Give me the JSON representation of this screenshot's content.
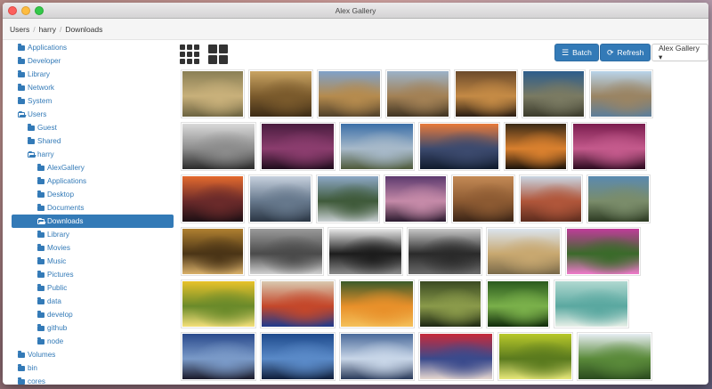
{
  "window": {
    "title": "Alex Gallery"
  },
  "breadcrumb": [
    "Users",
    "harry",
    "Downloads"
  ],
  "sidebar": {
    "items": [
      {
        "label": "Applications",
        "level": 0,
        "open": false,
        "selected": false
      },
      {
        "label": "Developer",
        "level": 0,
        "open": false,
        "selected": false
      },
      {
        "label": "Library",
        "level": 0,
        "open": false,
        "selected": false
      },
      {
        "label": "Network",
        "level": 0,
        "open": false,
        "selected": false
      },
      {
        "label": "System",
        "level": 0,
        "open": false,
        "selected": false
      },
      {
        "label": "Users",
        "level": 0,
        "open": true,
        "selected": false
      },
      {
        "label": "Guest",
        "level": 1,
        "open": false,
        "selected": false
      },
      {
        "label": "Shared",
        "level": 1,
        "open": false,
        "selected": false
      },
      {
        "label": "harry",
        "level": 1,
        "open": true,
        "selected": false
      },
      {
        "label": "AlexGallery",
        "level": 2,
        "open": false,
        "selected": false
      },
      {
        "label": "Applications",
        "level": 2,
        "open": false,
        "selected": false
      },
      {
        "label": "Desktop",
        "level": 2,
        "open": false,
        "selected": false
      },
      {
        "label": "Documents",
        "level": 2,
        "open": false,
        "selected": false
      },
      {
        "label": "Downloads",
        "level": 2,
        "open": true,
        "selected": true
      },
      {
        "label": "Library",
        "level": 2,
        "open": false,
        "selected": false
      },
      {
        "label": "Movies",
        "level": 2,
        "open": false,
        "selected": false
      },
      {
        "label": "Music",
        "level": 2,
        "open": false,
        "selected": false
      },
      {
        "label": "Pictures",
        "level": 2,
        "open": false,
        "selected": false
      },
      {
        "label": "Public",
        "level": 2,
        "open": false,
        "selected": false
      },
      {
        "label": "data",
        "level": 2,
        "open": false,
        "selected": false
      },
      {
        "label": "develop",
        "level": 2,
        "open": false,
        "selected": false
      },
      {
        "label": "github",
        "level": 2,
        "open": false,
        "selected": false
      },
      {
        "label": "node",
        "level": 2,
        "open": false,
        "selected": false
      },
      {
        "label": "Volumes",
        "level": 0,
        "open": false,
        "selected": false
      },
      {
        "label": "bin",
        "level": 0,
        "open": false,
        "selected": false
      },
      {
        "label": "cores",
        "level": 0,
        "open": false,
        "selected": false
      }
    ]
  },
  "toolbar": {
    "batch_label": "Batch",
    "refresh_label": "Refresh",
    "gallery_select_label": "Alex Gallery ▾",
    "small_grid_icon": "grid-9-icon",
    "large_grid_icon": "grid-4-icon",
    "batch_icon": "list-icon",
    "refresh_icon": "refresh-icon"
  },
  "colors": {
    "accent": "#337ab7",
    "accent_border": "#2e6da4"
  },
  "gallery": {
    "rows": [
      [
        {
          "name": "cheetah-running",
          "colors": [
            "#8a7f55",
            "#c8b07a",
            "#6b6240"
          ]
        },
        {
          "name": "leopard-closeup",
          "colors": [
            "#c9a463",
            "#7a5a2c",
            "#3d2c16"
          ]
        },
        {
          "name": "leopard-on-branch",
          "colors": [
            "#7fa1c9",
            "#b58b4e",
            "#50402a"
          ]
        },
        {
          "name": "leopard-resting-tree",
          "colors": [
            "#9bb2c8",
            "#a38155",
            "#3f3322"
          ]
        },
        {
          "name": "jaguar-lying",
          "colors": [
            "#6b4a2b",
            "#c48a45",
            "#2a1d12"
          ]
        },
        {
          "name": "jaguar-on-log",
          "colors": [
            "#2d5d8c",
            "#7a7a62",
            "#3a3a2b"
          ]
        },
        {
          "name": "jaguar-reflection",
          "colors": [
            "#b9d4ea",
            "#9a8463",
            "#5c7e9a"
          ]
        }
      ],
      [
        {
          "name": "statue-of-liberty",
          "colors": [
            "#d9d9d9",
            "#8c8c8c",
            "#2a2a2a"
          ]
        },
        {
          "name": "imac-purple",
          "colors": [
            "#4a1d3f",
            "#8b3d6e",
            "#1f0c1c"
          ]
        },
        {
          "name": "mountain-valley",
          "colors": [
            "#3b6fa8",
            "#a7b9c9",
            "#4e5a3a"
          ]
        },
        {
          "name": "mountain-lake-sunset",
          "colors": [
            "#e87a3a",
            "#3c4a6e",
            "#0f1a2c"
          ]
        },
        {
          "name": "tiger-in-water",
          "colors": [
            "#3a2a16",
            "#d9802e",
            "#1a120a"
          ]
        },
        {
          "name": "purple-wave",
          "colors": [
            "#7b1e4f",
            "#c45a8c",
            "#2a0a1e"
          ]
        }
      ],
      [
        {
          "name": "sunset-sea",
          "colors": [
            "#e46a2e",
            "#6a2a2a",
            "#1c0f14"
          ]
        },
        {
          "name": "lake-mountains",
          "colors": [
            "#c7d1de",
            "#66788c",
            "#2b3644"
          ]
        },
        {
          "name": "mountain-lake-reflection",
          "colors": [
            "#8da8c7",
            "#3f5a3a",
            "#c8cfd2"
          ]
        },
        {
          "name": "purple-mountains",
          "colors": [
            "#5c3a6e",
            "#c58aa8",
            "#2a1a2e"
          ]
        },
        {
          "name": "bear-sleeping",
          "colors": [
            "#c48a55",
            "#8c5a32",
            "#3a2416"
          ]
        },
        {
          "name": "red-rock-valley",
          "colors": [
            "#c9d6e3",
            "#b0563a",
            "#5c2c1e"
          ]
        },
        {
          "name": "yosemite-cliffs",
          "colors": [
            "#5a8ab0",
            "#7a8c6a",
            "#2c3a22"
          ]
        }
      ],
      [
        {
          "name": "leopard-face",
          "colors": [
            "#b08030",
            "#4a3416",
            "#d9b06a"
          ]
        },
        {
          "name": "wolf-grey",
          "colors": [
            "#9a9a9a",
            "#4a4a4a",
            "#d0d0d0"
          ]
        },
        {
          "name": "black-wolf-snow",
          "colors": [
            "#e8e8e8",
            "#1c1c1c",
            "#8a8a8a"
          ]
        },
        {
          "name": "black-wolf-forest",
          "colors": [
            "#c8c8c8",
            "#2a2a2a",
            "#6a6a6a"
          ]
        },
        {
          "name": "desert-plains",
          "colors": [
            "#dbe4ee",
            "#c8a870",
            "#7a6a4a"
          ]
        },
        {
          "name": "pink-peony",
          "colors": [
            "#c03c9a",
            "#3a6a2a",
            "#f07acc"
          ]
        }
      ],
      [
        {
          "name": "yellow-lilies",
          "colors": [
            "#e8c22a",
            "#6a8a2a",
            "#f4e07a"
          ]
        },
        {
          "name": "blue-berries-branch",
          "colors": [
            "#d9c9b0",
            "#c4472a",
            "#1e3a8c"
          ]
        },
        {
          "name": "orange-rose",
          "colors": [
            "#3a5a2a",
            "#e8902a",
            "#f4c05a"
          ]
        },
        {
          "name": "jungle-trees",
          "colors": [
            "#3a4a22",
            "#8a9a4a",
            "#1c2612"
          ]
        },
        {
          "name": "green-snake-leaves",
          "colors": [
            "#2a5a1e",
            "#7ab04a",
            "#0f2a0a"
          ]
        },
        {
          "name": "succulent-plant",
          "colors": [
            "#b0d8d0",
            "#5aa8a0",
            "#e8f0e8"
          ]
        }
      ],
      [
        {
          "name": "city-coast-dusk",
          "colors": [
            "#2a4a8c",
            "#7a9ac8",
            "#1a1a2a"
          ]
        },
        {
          "name": "ocean-blue-pier",
          "colors": [
            "#1e4a8c",
            "#5a8ac8",
            "#0f1e3a"
          ]
        },
        {
          "name": "aerial-clouds",
          "colors": [
            "#4a6a9a",
            "#c8d6e8",
            "#2a3a5a"
          ]
        },
        {
          "name": "red-blue-berries",
          "colors": [
            "#c82a3a",
            "#3a4a8c",
            "#e8d8d0"
          ]
        },
        {
          "name": "yellow-leaves",
          "colors": [
            "#b8c82a",
            "#5a7a1e",
            "#e8e87a"
          ]
        },
        {
          "name": "green-field-tree",
          "colors": [
            "#e8eef4",
            "#5a8a3a",
            "#2a4a1e"
          ]
        }
      ]
    ]
  }
}
